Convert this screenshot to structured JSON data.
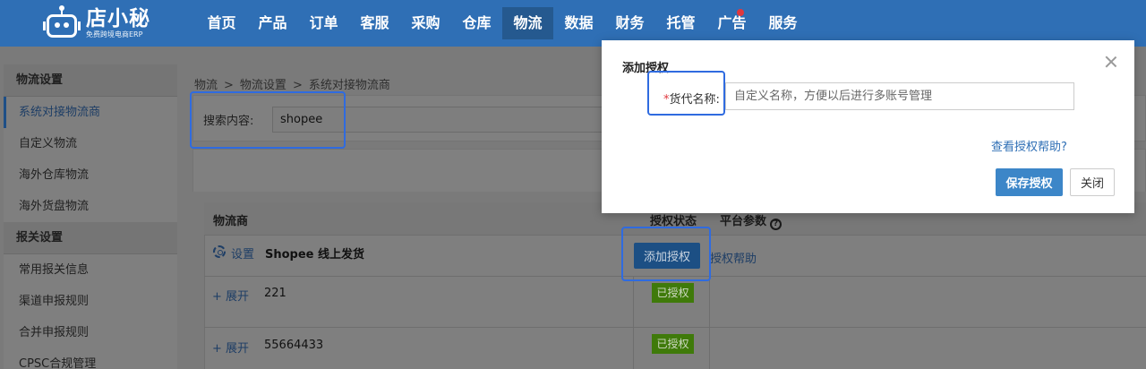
{
  "logo": {
    "title": "店小秘",
    "subtitle": "免费跨境电商ERP"
  },
  "nav": [
    {
      "label": "首页"
    },
    {
      "label": "产品"
    },
    {
      "label": "订单"
    },
    {
      "label": "客服"
    },
    {
      "label": "采购"
    },
    {
      "label": "仓库"
    },
    {
      "label": "物流"
    },
    {
      "label": "数据"
    },
    {
      "label": "财务"
    },
    {
      "label": "托管"
    },
    {
      "label": "广告"
    },
    {
      "label": "服务"
    }
  ],
  "sidebar": {
    "group1": "物流设置",
    "items1": [
      "系统对接物流商",
      "自定义物流",
      "海外仓库物流",
      "海外货盘物流"
    ],
    "group2": "报关设置",
    "items2": [
      "常用报关信息",
      "渠道申报规则",
      "合并申报规则",
      "CPSC合规管理"
    ]
  },
  "breadcrumb": [
    "物流",
    "物流设置",
    "系统对接物流商"
  ],
  "search": {
    "label": "搜索内容:",
    "value": "shopee"
  },
  "table": {
    "headers": {
      "provider": "物流商",
      "status": "授权状态",
      "params": "平台参数"
    },
    "settings_label": "设置",
    "provider_name": "Shopee 线上发货",
    "add_auth_label": "添加授权",
    "auth_help_label": "授权帮助",
    "rows": [
      {
        "expand": "+ 展开",
        "account": "221",
        "status": "已授权"
      },
      {
        "expand": "+ 展开",
        "account": "55664433",
        "status": "已授权"
      }
    ]
  },
  "modal": {
    "title": "添加授权",
    "field_required": "*",
    "field_label": "货代名称:",
    "field_placeholder": "自定义名称，方便以后进行多账号管理",
    "help_link": "查看授权帮助?",
    "save_label": "保存授权",
    "close_label": "关闭"
  },
  "colors": {
    "nav_bg": "#2f6fb5",
    "primary_button": "#3c86c8",
    "authorized_badge": "#3f7a0a",
    "highlight": "#2f6be0"
  }
}
